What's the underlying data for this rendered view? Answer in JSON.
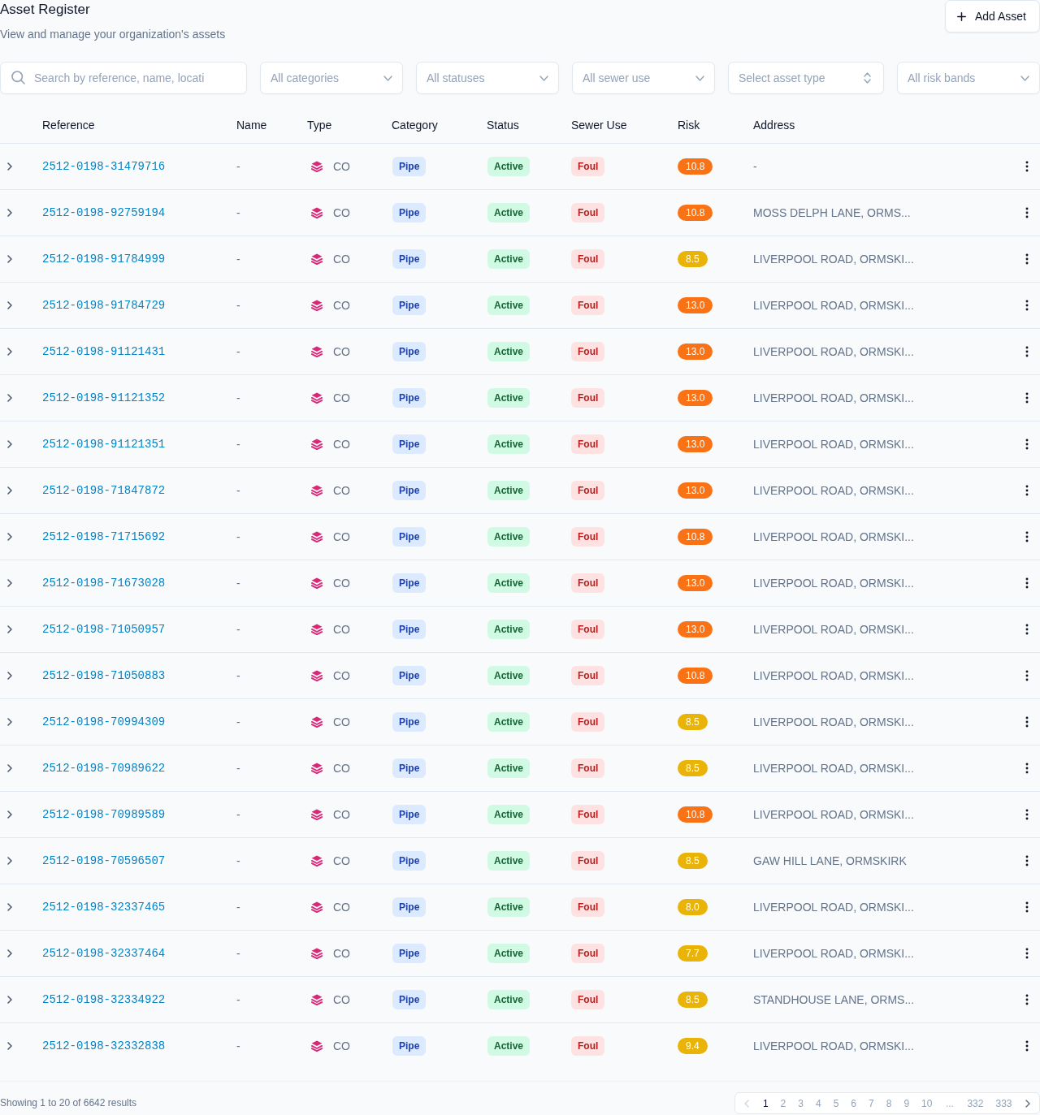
{
  "header": {
    "title": "Asset Register",
    "subtitle": "View and manage your organization's assets",
    "add_button": "Add Asset"
  },
  "filters": [
    {
      "kind": "search",
      "placeholder": "Search by reference, name, locati"
    },
    {
      "kind": "select",
      "placeholder": "All categories"
    },
    {
      "kind": "select",
      "placeholder": "All statuses"
    },
    {
      "kind": "select",
      "placeholder": "All sewer use"
    },
    {
      "kind": "combobox",
      "placeholder": "Select asset type"
    },
    {
      "kind": "select",
      "placeholder": "All risk bands"
    }
  ],
  "table": {
    "columns": [
      "Reference",
      "Name",
      "Type",
      "Category",
      "Status",
      "Sewer Use",
      "Risk",
      "Address"
    ],
    "rows": [
      {
        "expanded": false,
        "reference": "2512-0198-31479716",
        "name": "-",
        "type": "CO",
        "category": "Pipe",
        "status": "Active",
        "sewer_use": "Foul",
        "risk": {
          "score": "10.8",
          "color": "#f97316"
        },
        "address": "-"
      },
      {
        "expanded": false,
        "reference": "2512-0198-92759194",
        "name": "-",
        "type": "CO",
        "category": "Pipe",
        "status": "Active",
        "sewer_use": "Foul",
        "risk": {
          "score": "10.8",
          "color": "#f97316"
        },
        "address": "MOSS DELPH LANE, ORMS..."
      },
      {
        "expanded": false,
        "reference": "2512-0198-91784999",
        "name": "-",
        "type": "CO",
        "category": "Pipe",
        "status": "Active",
        "sewer_use": "Foul",
        "risk": {
          "score": "8.5",
          "color": "#eab308"
        },
        "address": "LIVERPOOL ROAD, ORMSKI..."
      },
      {
        "expanded": false,
        "reference": "2512-0198-91784729",
        "name": "-",
        "type": "CO",
        "category": "Pipe",
        "status": "Active",
        "sewer_use": "Foul",
        "risk": {
          "score": "13.0",
          "color": "#f97316"
        },
        "address": "LIVERPOOL ROAD, ORMSKI..."
      },
      {
        "expanded": false,
        "reference": "2512-0198-91121431",
        "name": "-",
        "type": "CO",
        "category": "Pipe",
        "status": "Active",
        "sewer_use": "Foul",
        "risk": {
          "score": "13.0",
          "color": "#f97316"
        },
        "address": "LIVERPOOL ROAD, ORMSKI..."
      },
      {
        "expanded": false,
        "reference": "2512-0198-91121352",
        "name": "-",
        "type": "CO",
        "category": "Pipe",
        "status": "Active",
        "sewer_use": "Foul",
        "risk": {
          "score": "13.0",
          "color": "#f97316"
        },
        "address": "LIVERPOOL ROAD, ORMSKI..."
      },
      {
        "expanded": false,
        "reference": "2512-0198-91121351",
        "name": "-",
        "type": "CO",
        "category": "Pipe",
        "status": "Active",
        "sewer_use": "Foul",
        "risk": {
          "score": "13.0",
          "color": "#f97316"
        },
        "address": "LIVERPOOL ROAD, ORMSKI..."
      },
      {
        "expanded": false,
        "reference": "2512-0198-71847872",
        "name": "-",
        "type": "CO",
        "category": "Pipe",
        "status": "Active",
        "sewer_use": "Foul",
        "risk": {
          "score": "13.0",
          "color": "#f97316"
        },
        "address": "LIVERPOOL ROAD, ORMSKI..."
      },
      {
        "expanded": false,
        "reference": "2512-0198-71715692",
        "name": "-",
        "type": "CO",
        "category": "Pipe",
        "status": "Active",
        "sewer_use": "Foul",
        "risk": {
          "score": "10.8",
          "color": "#f97316"
        },
        "address": "LIVERPOOL ROAD, ORMSKI..."
      },
      {
        "expanded": false,
        "reference": "2512-0198-71673028",
        "name": "-",
        "type": "CO",
        "category": "Pipe",
        "status": "Active",
        "sewer_use": "Foul",
        "risk": {
          "score": "13.0",
          "color": "#f97316"
        },
        "address": "LIVERPOOL ROAD, ORMSKI..."
      },
      {
        "expanded": false,
        "reference": "2512-0198-71050957",
        "name": "-",
        "type": "CO",
        "category": "Pipe",
        "status": "Active",
        "sewer_use": "Foul",
        "risk": {
          "score": "13.0",
          "color": "#f97316"
        },
        "address": "LIVERPOOL ROAD, ORMSKI..."
      },
      {
        "expanded": false,
        "reference": "2512-0198-71050883",
        "name": "-",
        "type": "CO",
        "category": "Pipe",
        "status": "Active",
        "sewer_use": "Foul",
        "risk": {
          "score": "10.8",
          "color": "#f97316"
        },
        "address": "LIVERPOOL ROAD, ORMSKI..."
      },
      {
        "expanded": false,
        "reference": "2512-0198-70994309",
        "name": "-",
        "type": "CO",
        "category": "Pipe",
        "status": "Active",
        "sewer_use": "Foul",
        "risk": {
          "score": "8.5",
          "color": "#eab308"
        },
        "address": "LIVERPOOL ROAD, ORMSKI..."
      },
      {
        "expanded": false,
        "reference": "2512-0198-70989622",
        "name": "-",
        "type": "CO",
        "category": "Pipe",
        "status": "Active",
        "sewer_use": "Foul",
        "risk": {
          "score": "8.5",
          "color": "#eab308"
        },
        "address": "LIVERPOOL ROAD, ORMSKI..."
      },
      {
        "expanded": false,
        "reference": "2512-0198-70989589",
        "name": "-",
        "type": "CO",
        "category": "Pipe",
        "status": "Active",
        "sewer_use": "Foul",
        "risk": {
          "score": "10.8",
          "color": "#f97316"
        },
        "address": "LIVERPOOL ROAD, ORMSKI..."
      },
      {
        "expanded": false,
        "reference": "2512-0198-70596507",
        "name": "-",
        "type": "CO",
        "category": "Pipe",
        "status": "Active",
        "sewer_use": "Foul",
        "risk": {
          "score": "8.5",
          "color": "#eab308"
        },
        "address": "GAW HILL LANE, ORMSKIRK"
      },
      {
        "expanded": false,
        "reference": "2512-0198-32337465",
        "name": "-",
        "type": "CO",
        "category": "Pipe",
        "status": "Active",
        "sewer_use": "Foul",
        "risk": {
          "score": "8.0",
          "color": "#eab308"
        },
        "address": "LIVERPOOL ROAD, ORMSKI..."
      },
      {
        "expanded": false,
        "reference": "2512-0198-32337464",
        "name": "-",
        "type": "CO",
        "category": "Pipe",
        "status": "Active",
        "sewer_use": "Foul",
        "risk": {
          "score": "7.7",
          "color": "#eab308"
        },
        "address": "LIVERPOOL ROAD, ORMSKI..."
      },
      {
        "expanded": false,
        "reference": "2512-0198-32334922",
        "name": "-",
        "type": "CO",
        "category": "Pipe",
        "status": "Active",
        "sewer_use": "Foul",
        "risk": {
          "score": "8.5",
          "color": "#eab308"
        },
        "address": "STANDHOUSE LANE, ORMS..."
      },
      {
        "expanded": false,
        "reference": "2512-0198-32332838",
        "name": "-",
        "type": "CO",
        "category": "Pipe",
        "status": "Active",
        "sewer_use": "Foul",
        "risk": {
          "score": "9.4",
          "color": "#eab308"
        },
        "address": "LIVERPOOL ROAD, ORMSKI..."
      }
    ]
  },
  "footer": {
    "summary": "Showing 1 to 20 of 6642 results",
    "pagination": {
      "prev": {
        "disabled": true
      },
      "next": {
        "disabled": false
      },
      "pages": [
        {
          "kind": "page",
          "label": "1",
          "selected": true
        },
        {
          "kind": "page",
          "label": "2",
          "selected": false
        },
        {
          "kind": "page",
          "label": "3",
          "selected": false
        },
        {
          "kind": "page",
          "label": "4",
          "selected": false
        },
        {
          "kind": "page",
          "label": "5",
          "selected": false
        },
        {
          "kind": "page",
          "label": "6",
          "selected": false
        },
        {
          "kind": "page",
          "label": "7",
          "selected": false
        },
        {
          "kind": "page",
          "label": "8",
          "selected": false
        },
        {
          "kind": "page",
          "label": "9",
          "selected": false
        },
        {
          "kind": "page",
          "label": "10",
          "selected": false
        },
        {
          "kind": "ellipsis",
          "label": "..."
        },
        {
          "kind": "page",
          "label": "332",
          "selected": false
        },
        {
          "kind": "page",
          "label": "333",
          "selected": false
        }
      ]
    }
  }
}
